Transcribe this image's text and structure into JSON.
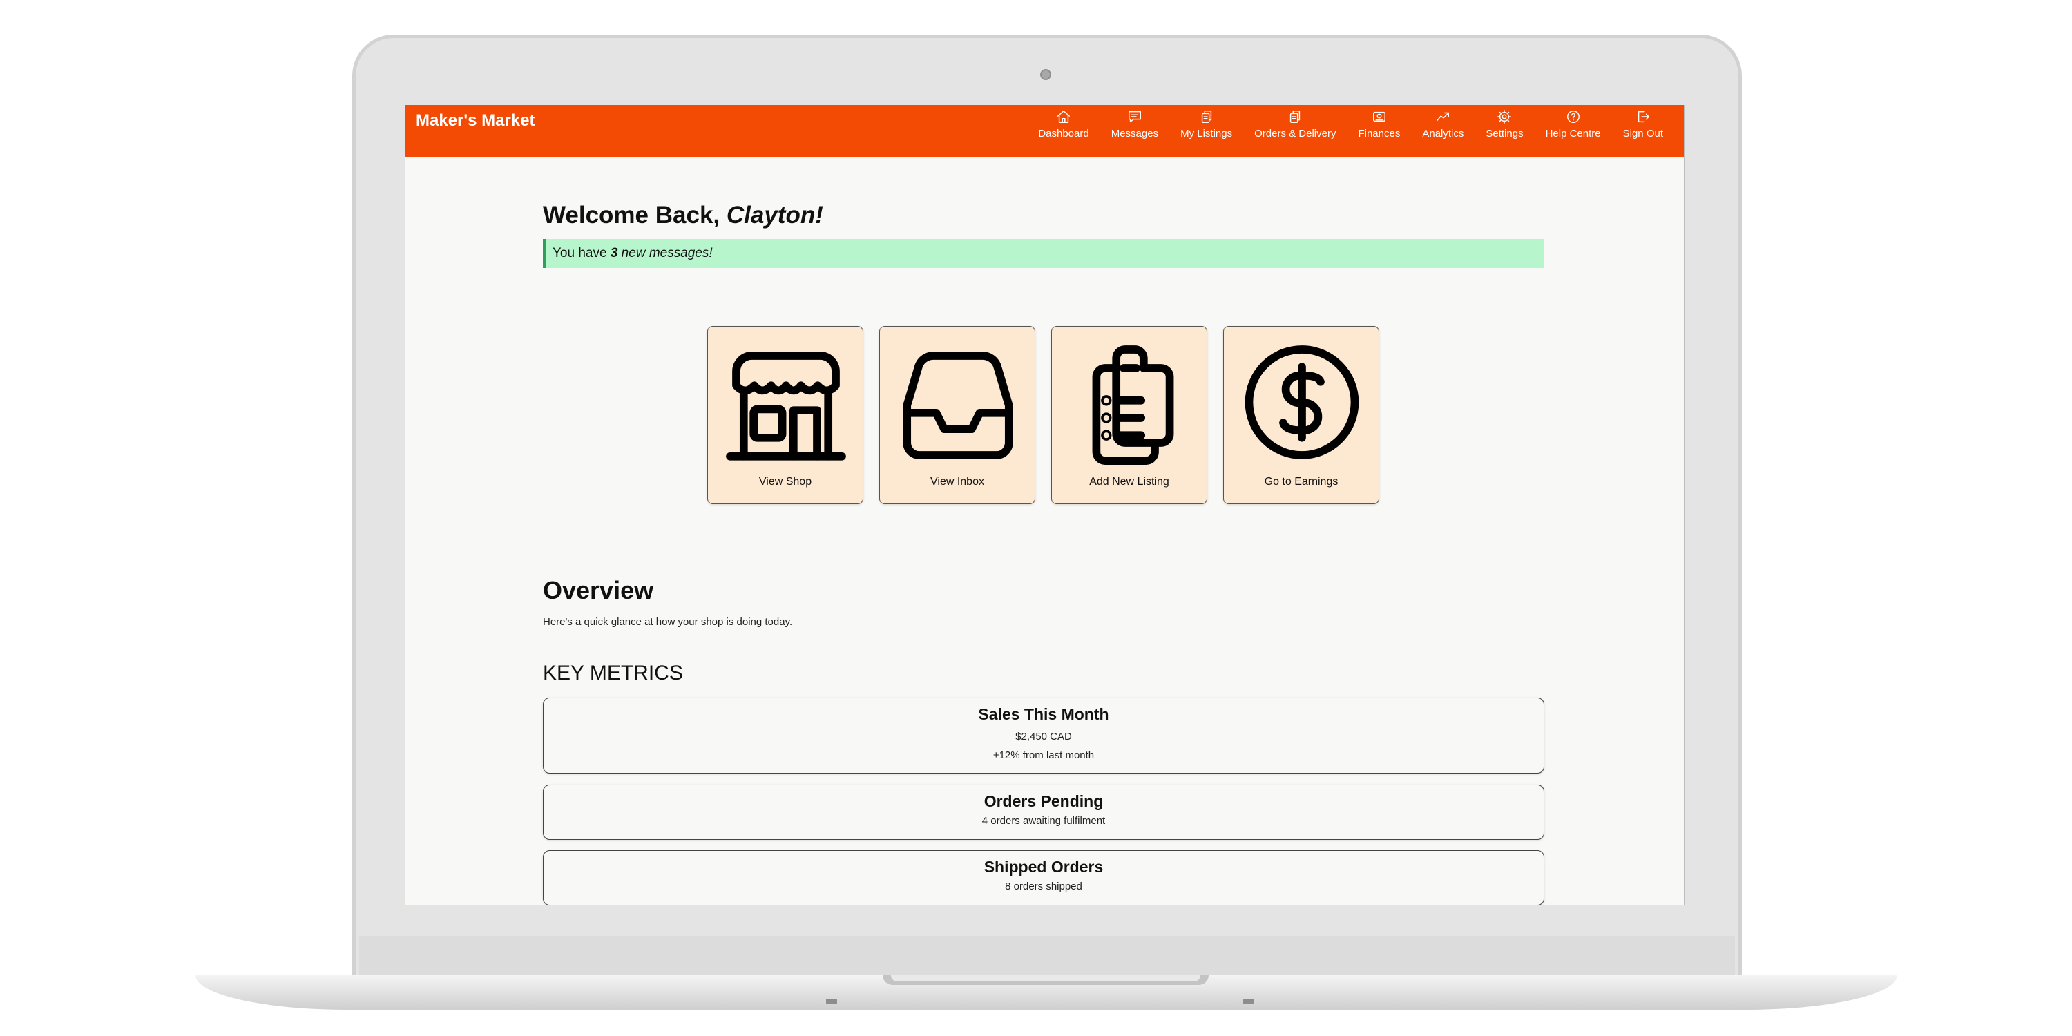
{
  "app": {
    "brand": "Maker's Market"
  },
  "nav": [
    {
      "label": "Dashboard",
      "icon": "home-icon"
    },
    {
      "label": "Messages",
      "icon": "chat-icon"
    },
    {
      "label": "My Listings",
      "icon": "copy-icon"
    },
    {
      "label": "Orders & Delivery",
      "icon": "copy-icon"
    },
    {
      "label": "Finances",
      "icon": "wallet-icon"
    },
    {
      "label": "Analytics",
      "icon": "trend-up-icon"
    },
    {
      "label": "Settings",
      "icon": "gear-icon"
    },
    {
      "label": "Help Centre",
      "icon": "help-circle-icon"
    },
    {
      "label": "Sign Out",
      "icon": "sign-out-icon"
    }
  ],
  "welcome": {
    "prefix": "Welcome Back, ",
    "name": "Clayton!"
  },
  "notice": {
    "prefix": "You have ",
    "count": "3",
    "suffix": " new messages!"
  },
  "quick_actions": [
    {
      "label": "View Shop",
      "icon": "storefront-icon"
    },
    {
      "label": "View Inbox",
      "icon": "inbox-tray-icon"
    },
    {
      "label": "Add New Listing",
      "icon": "clipboard-list-icon"
    },
    {
      "label": "Go to Earnings",
      "icon": "dollar-circle-icon"
    }
  ],
  "overview": {
    "title": "Overview",
    "subtitle": "Here's a quick glance at how your shop is doing today."
  },
  "key_metrics": {
    "title": "KEY METRICS",
    "items": [
      {
        "title": "Sales This Month",
        "lines": [
          "$2,450 CAD",
          "+12% from last month"
        ]
      },
      {
        "title": "Orders Pending",
        "lines": [
          "4 orders awaiting fulfilment"
        ]
      },
      {
        "title": "Shipped Orders",
        "lines": [
          "8 orders shipped"
        ]
      }
    ]
  },
  "colors": {
    "accent": "#f34a04",
    "card_bg": "#fde9d2",
    "notice_bg": "#b7f5cd",
    "page_bg": "#f8f8f6"
  }
}
